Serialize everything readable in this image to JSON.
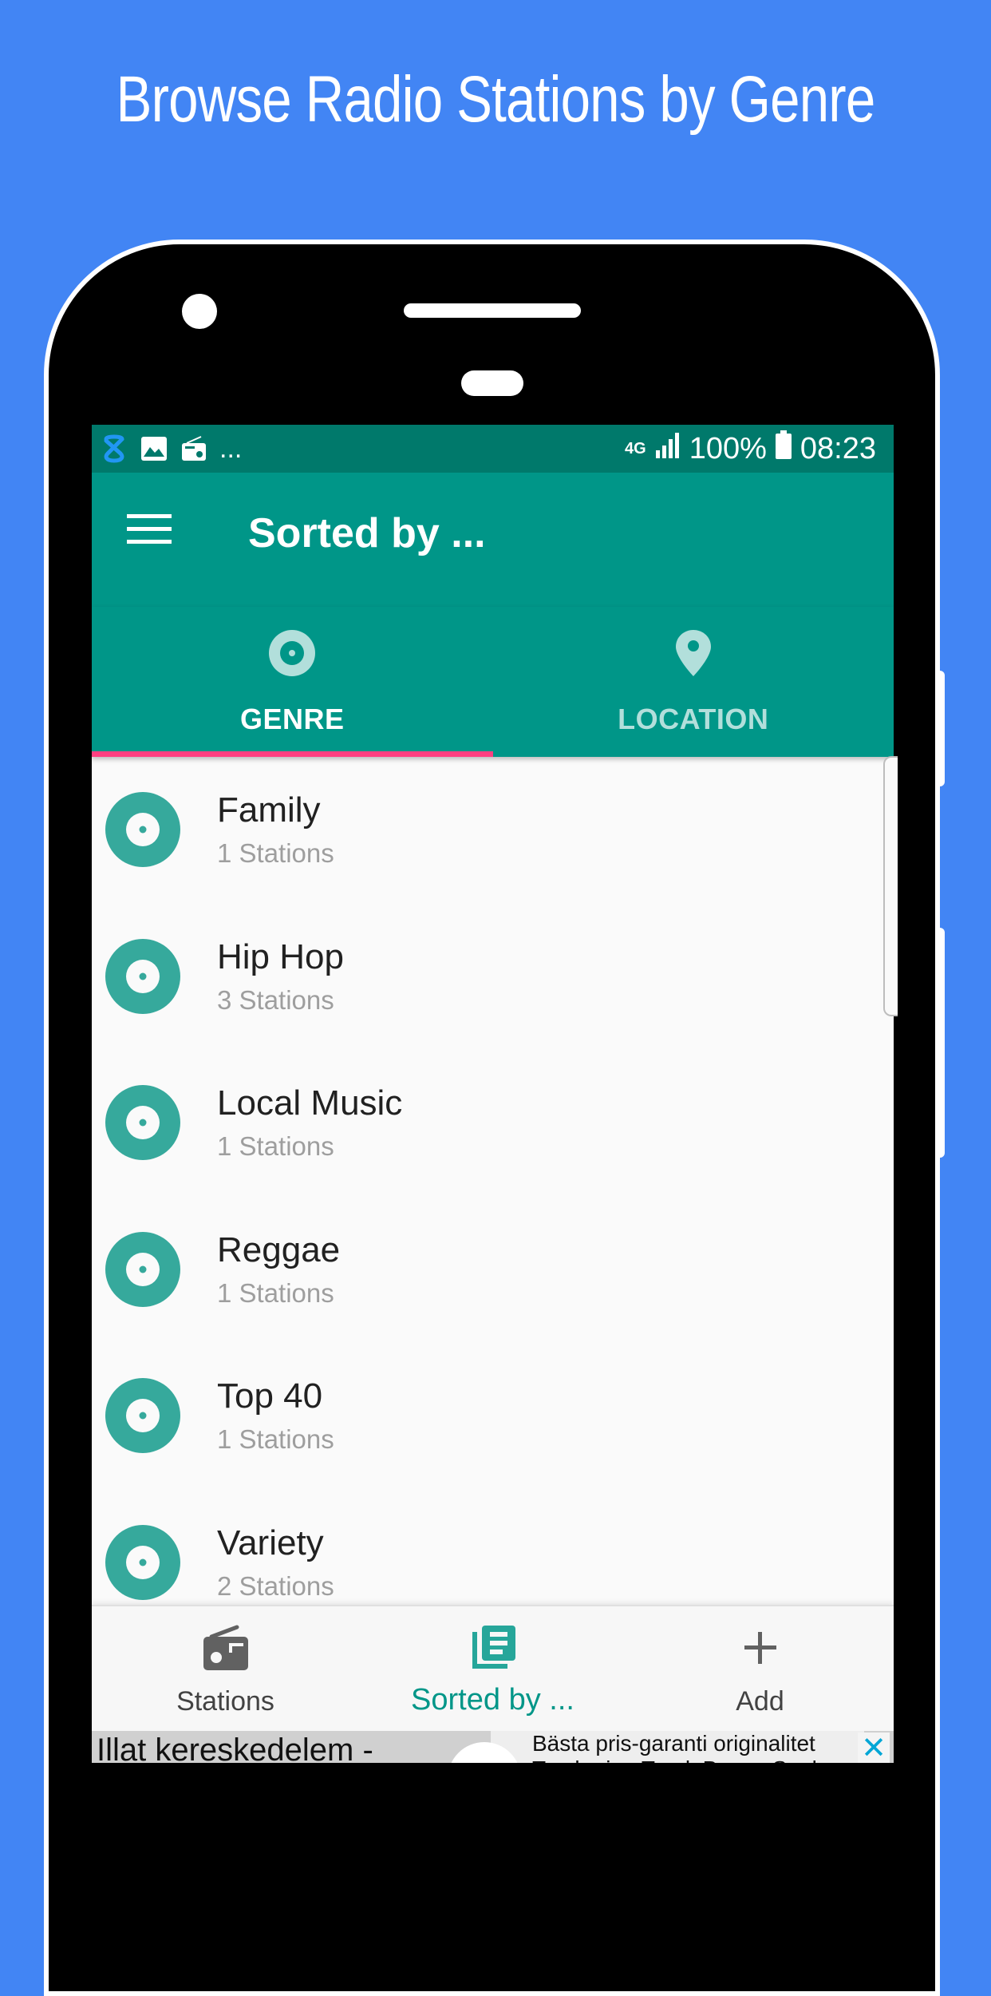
{
  "headline": "Browse Radio Stations by Genre",
  "status_bar": {
    "left_icons": [
      "shield-app-icon",
      "image-icon",
      "radio-app-icon"
    ],
    "overflow": "...",
    "network": "4G",
    "battery": "100%",
    "time": "08:23"
  },
  "toolbar": {
    "menu_icon": "hamburger-menu-icon",
    "title": "Sorted by ..."
  },
  "tabs": [
    {
      "label": "GENRE",
      "icon": "disc-icon",
      "active": true
    },
    {
      "label": "LOCATION",
      "icon": "location-pin-icon",
      "active": false
    }
  ],
  "genres": [
    {
      "name": "Family",
      "count": "1 Stations"
    },
    {
      "name": "Hip Hop",
      "count": "3 Stations"
    },
    {
      "name": "Local Music",
      "count": "1 Stations"
    },
    {
      "name": "Reggae",
      "count": "1 Stations"
    },
    {
      "name": "Top 40",
      "count": "1 Stations"
    },
    {
      "name": "Variety",
      "count": "2 Stations"
    }
  ],
  "bottom_nav": [
    {
      "label": "Stations",
      "icon": "radio-icon",
      "active": false
    },
    {
      "label": "Sorted by ...",
      "icon": "library-icon",
      "active": true
    },
    {
      "label": "Add",
      "icon": "plus-icon",
      "active": false
    }
  ],
  "ad": {
    "left_text": "Illat kereskedelem -",
    "right_text_line1": "Bästa pris-garanti originalitet",
    "right_text_line2": "Tryckeri ... Track Bonus Sank",
    "close_label": "✕"
  },
  "colors": {
    "background": "#4285f4",
    "primary": "#009688",
    "primary_dark": "#00796b",
    "accent": "#ff4081",
    "icon_teal": "#36a99c"
  }
}
